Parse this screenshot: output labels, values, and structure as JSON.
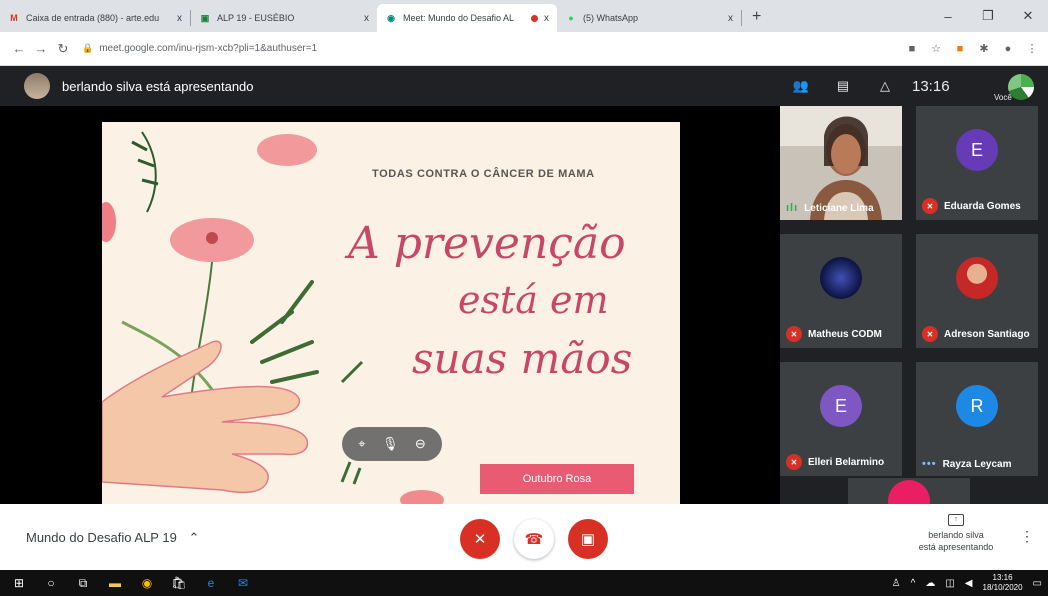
{
  "browser": {
    "tabs": [
      {
        "title": "Caixa de entrada (880) - arte.edu",
        "favicon": "gmail-icon",
        "favicon_glyph": "M",
        "favicon_color": "#d93025",
        "close": "x"
      },
      {
        "title": "ALP 19 - EUSÉBIO",
        "favicon": "classroom-icon",
        "favicon_glyph": "▣",
        "favicon_color": "#188038",
        "close": "x"
      },
      {
        "title": "Meet: Mundo do Desafio AL",
        "favicon": "meet-icon",
        "favicon_glyph": "◉",
        "favicon_color": "#00897b",
        "close": "x",
        "active": true
      },
      {
        "title": "(5) WhatsApp",
        "favicon": "whatsapp-icon",
        "favicon_glyph": "●",
        "favicon_color": "#25d366",
        "close": "x"
      }
    ],
    "new_tab": "+",
    "url": "meet.google.com/inu-rjsm-xcb?pli=1&authuser=1"
  },
  "meet": {
    "presenter_label": "berlando silva está apresentando",
    "clock": "13:16",
    "you_label": "Você",
    "slide": {
      "kicker": "TODAS CONTRA O CÂNCER DE MAMA",
      "line1": "A prevenção",
      "line2": "está em",
      "line3": "suas mãos",
      "badge": "Outubro Rosa"
    },
    "participants": [
      {
        "name": "Leticiane Lima",
        "status": "speaking",
        "avatar_type": "photo"
      },
      {
        "name": "Eduarda Gomes",
        "status": "muted",
        "avatar_type": "initial",
        "initial": "E",
        "color": "#673ab7"
      },
      {
        "name": "Matheus CODM",
        "status": "muted",
        "avatar_type": "image"
      },
      {
        "name": "Adreson Santiago",
        "status": "muted",
        "avatar_type": "image"
      },
      {
        "name": "Elleri Belarmino",
        "status": "muted",
        "avatar_type": "initial",
        "initial": "E",
        "color": "#7e57c2"
      },
      {
        "name": "Rayza Leycam",
        "status": "active",
        "avatar_type": "initial",
        "initial": "R",
        "color": "#1e88e5"
      }
    ],
    "meeting_name": "Mundo do Desafio ALP 19",
    "present_label_line1": "berlando silva",
    "present_label_line2": "está apresentando"
  },
  "taskbar": {
    "time": "13:16",
    "date": "18/10/2020"
  },
  "colors": {
    "accent_red": "#d93025",
    "slide_pink": "#c64766",
    "slide_bg": "#fbf2e5"
  }
}
